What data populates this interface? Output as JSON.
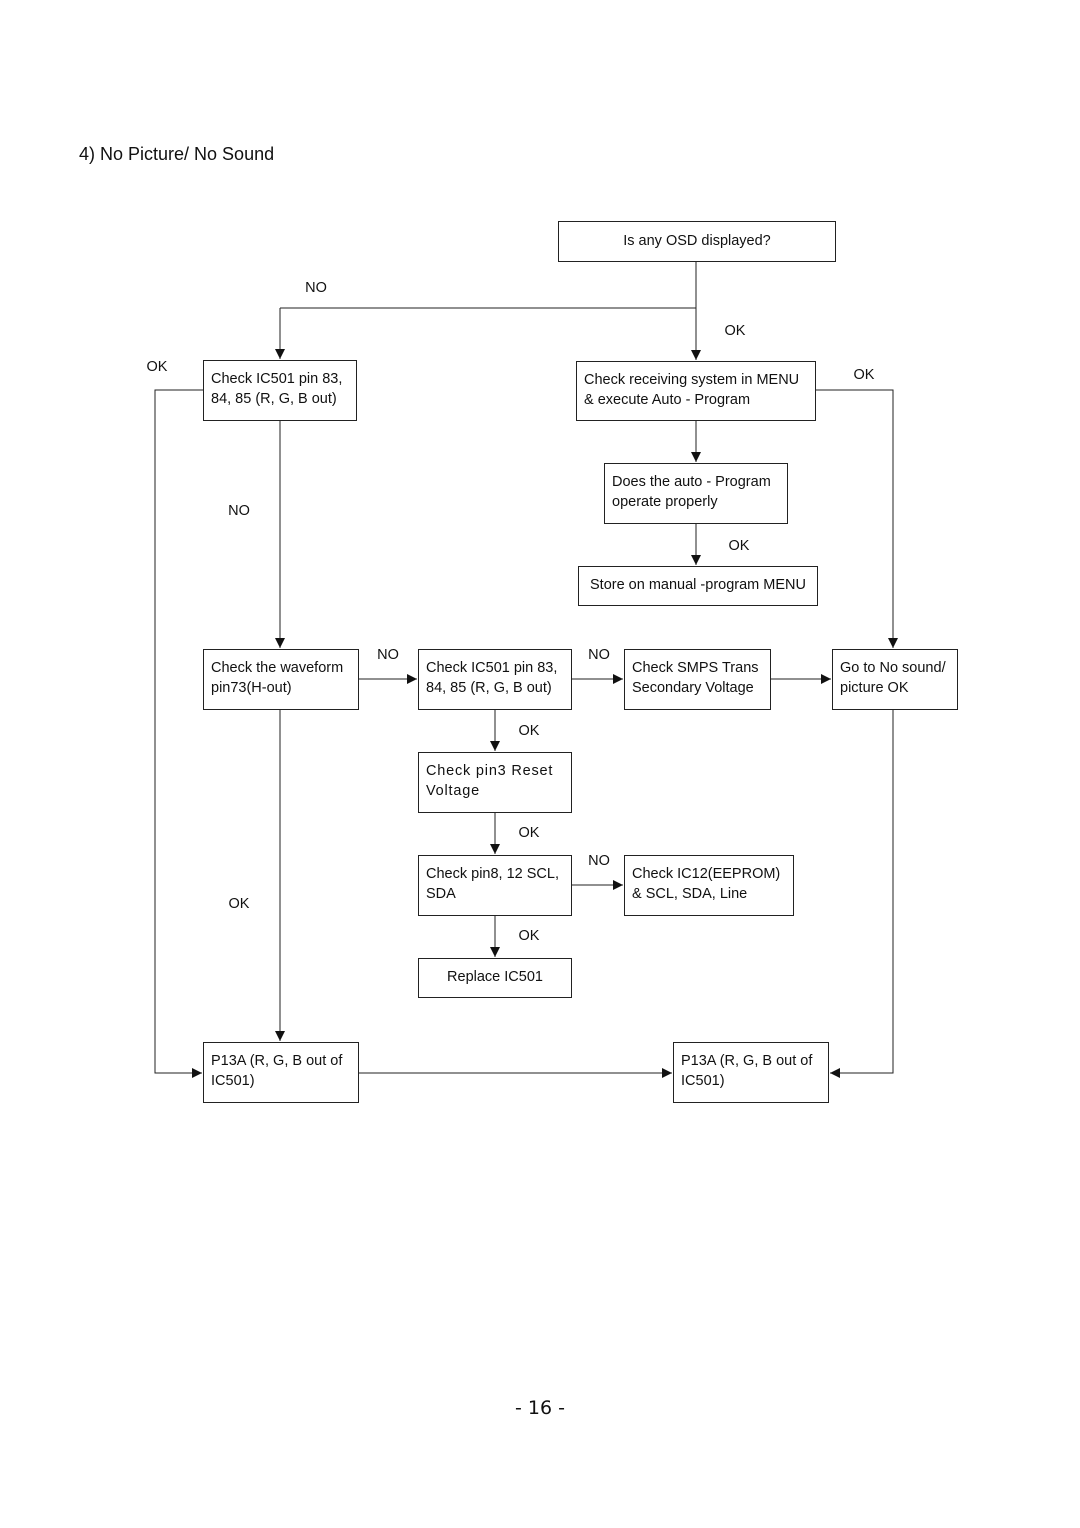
{
  "title": "4) No Picture/ No Sound",
  "page_number": "- 16 -",
  "nodes": {
    "osd": "Is any OSD displayed?",
    "ic501_a": "Check IC501 pin 83, 84, 85 (R, G, B out)",
    "receiving": "Check receiving system in MENU & execute Auto - Program",
    "auto_program": "Does the auto - Program operate properly",
    "store": "Store on manual -program MENU",
    "waveform": "Check the waveform pin73(H-out)",
    "ic501_b": "Check IC501 pin 83, 84, 85 (R, G, B out)",
    "smps": "Check SMPS Trans Secondary Voltage",
    "goto": "Go to No sound/ picture OK",
    "pin3": "Check pin3 Reset Voltage",
    "pin8": "Check pin8, 12 SCL, SDA",
    "ic12": "Check IC12(EEPROM) & SCL, SDA, Line",
    "replace": "Replace IC501",
    "p13a_left": "P13A (R, G, B out of IC501)",
    "p13a_right": "P13A (R, G, B out of IC501)"
  },
  "edge_labels": {
    "osd_no": "NO",
    "osd_ok": "OK",
    "ic501a_ok": "OK",
    "ic501a_no": "NO",
    "receiving_ok": "OK",
    "auto_ok": "OK",
    "waveform_no": "NO",
    "ic501b_no": "NO",
    "ic501b_ok": "OK",
    "pin3_ok": "OK",
    "pin8_no": "NO",
    "pin8_ok": "OK",
    "waveform_ok": "OK"
  }
}
